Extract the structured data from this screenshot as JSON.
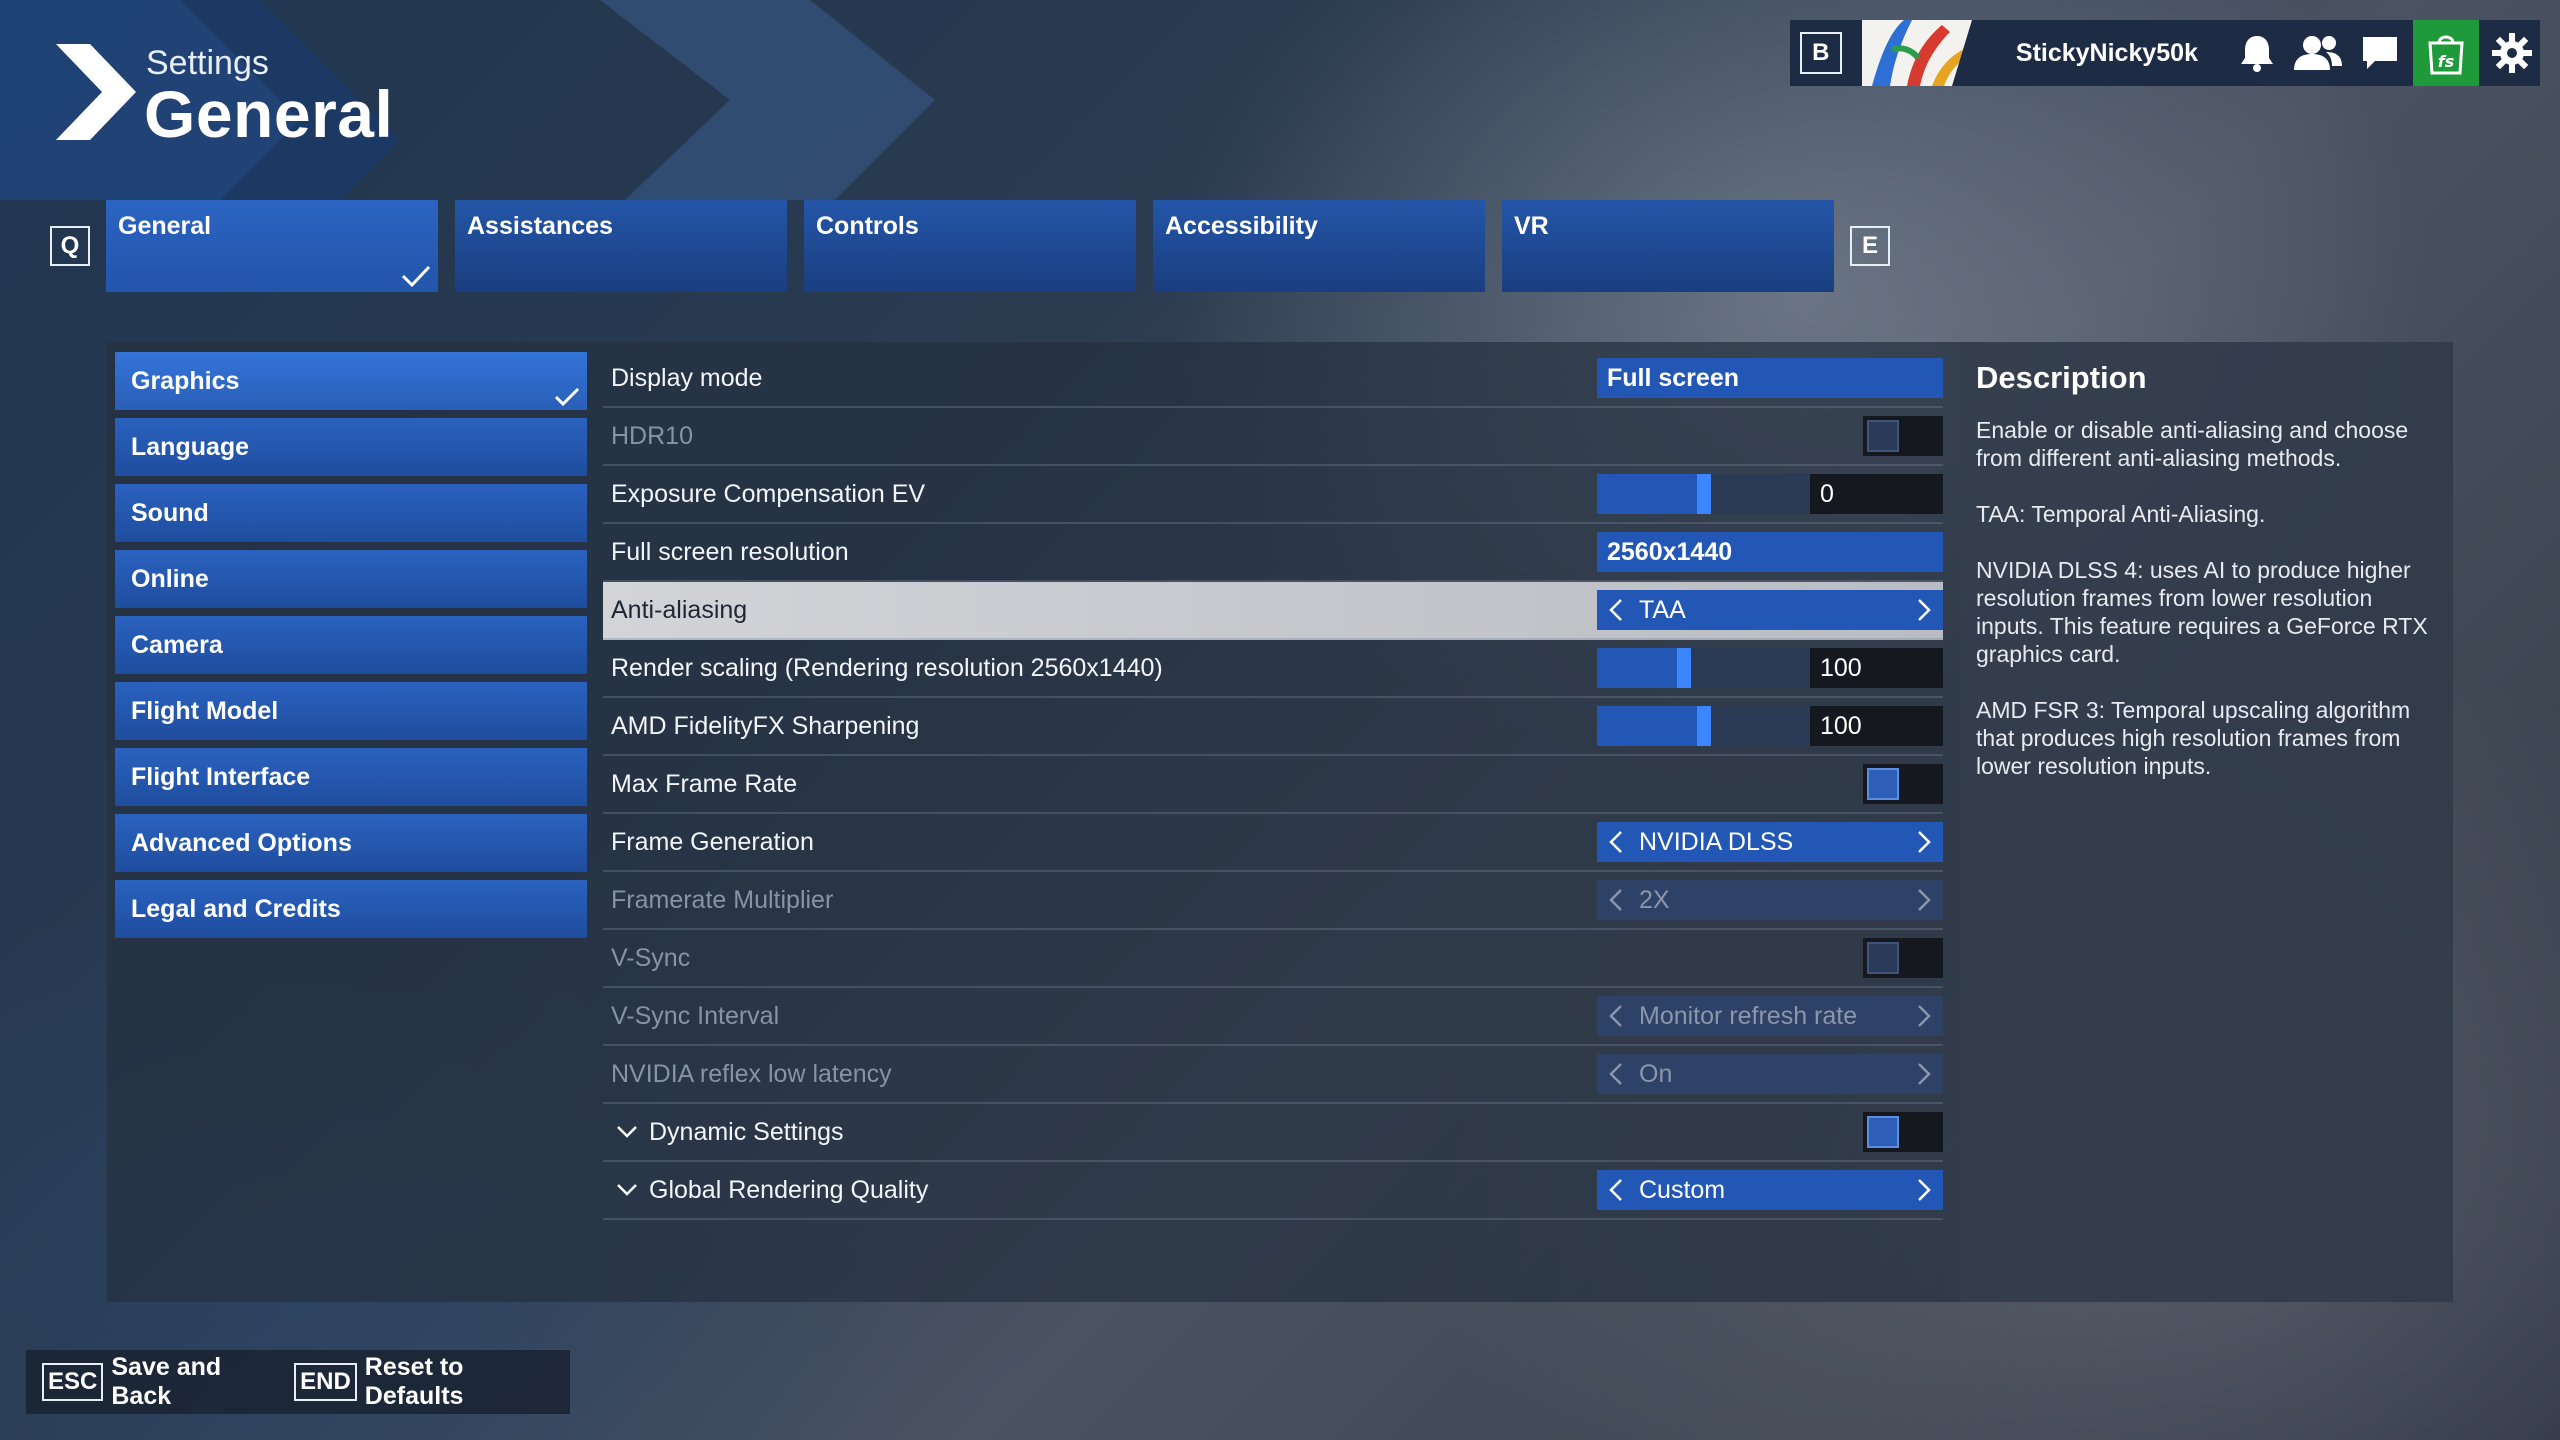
{
  "header": {
    "subtitle": "Settings",
    "title": "General"
  },
  "topbar": {
    "key": "B",
    "username": "StickyNicky50k",
    "icons": [
      "bell-icon",
      "friends-icon",
      "chat-icon",
      "store-icon",
      "gear-icon"
    ]
  },
  "tabs": {
    "prev_key": "Q",
    "next_key": "E",
    "items": [
      {
        "label": "General"
      },
      {
        "label": "Assistances"
      },
      {
        "label": "Controls"
      },
      {
        "label": "Accessibility"
      },
      {
        "label": "VR"
      }
    ]
  },
  "categories": [
    {
      "label": "Graphics"
    },
    {
      "label": "Language"
    },
    {
      "label": "Sound"
    },
    {
      "label": "Online"
    },
    {
      "label": "Camera"
    },
    {
      "label": "Flight Model"
    },
    {
      "label": "Flight Interface"
    },
    {
      "label": "Advanced Options"
    },
    {
      "label": "Legal and Credits"
    }
  ],
  "settings": {
    "display_mode": {
      "label": "Display mode",
      "value": "Full screen"
    },
    "hdr10": {
      "label": "HDR10"
    },
    "exposure": {
      "label": "Exposure Compensation EV",
      "value": "0",
      "fill": 0.5
    },
    "resolution": {
      "label": "Full screen resolution",
      "value": "2560x1440"
    },
    "anti_aliasing": {
      "label": "Anti-aliasing",
      "value": "TAA"
    },
    "render_scaling": {
      "label": "Render scaling (Rendering resolution 2560x1440)",
      "value": "100",
      "fill": 0.41
    },
    "fidelityfx": {
      "label": "AMD FidelityFX Sharpening",
      "value": "100",
      "fill": 0.5
    },
    "max_frame_rate": {
      "label": "Max Frame Rate"
    },
    "frame_generation": {
      "label": "Frame Generation",
      "value": "NVIDIA DLSS"
    },
    "framerate_multiplier": {
      "label": "Framerate Multiplier",
      "value": "2X"
    },
    "vsync": {
      "label": "V-Sync"
    },
    "vsync_interval": {
      "label": "V-Sync Interval",
      "value": "Monitor refresh rate"
    },
    "reflex": {
      "label": "NVIDIA reflex low latency",
      "value": "On"
    },
    "dynamic_settings": {
      "label": "Dynamic Settings"
    },
    "global_quality": {
      "label": "Global Rendering Quality",
      "value": "Custom"
    }
  },
  "description": {
    "title": "Description",
    "paragraphs": [
      "Enable or disable anti-aliasing and choose from different anti-aliasing methods.",
      "TAA: Temporal Anti-Aliasing.",
      "NVIDIA DLSS 4: uses AI to produce higher resolution frames from lower resolution inputs. This feature requires a GeForce RTX graphics card.",
      "AMD FSR 3: Temporal upscaling algorithm that produces high resolution frames from lower resolution inputs."
    ]
  },
  "footer": {
    "save_key": "ESC",
    "save_label": "Save and Back",
    "reset_key": "END",
    "reset_label": "Reset to Defaults"
  }
}
